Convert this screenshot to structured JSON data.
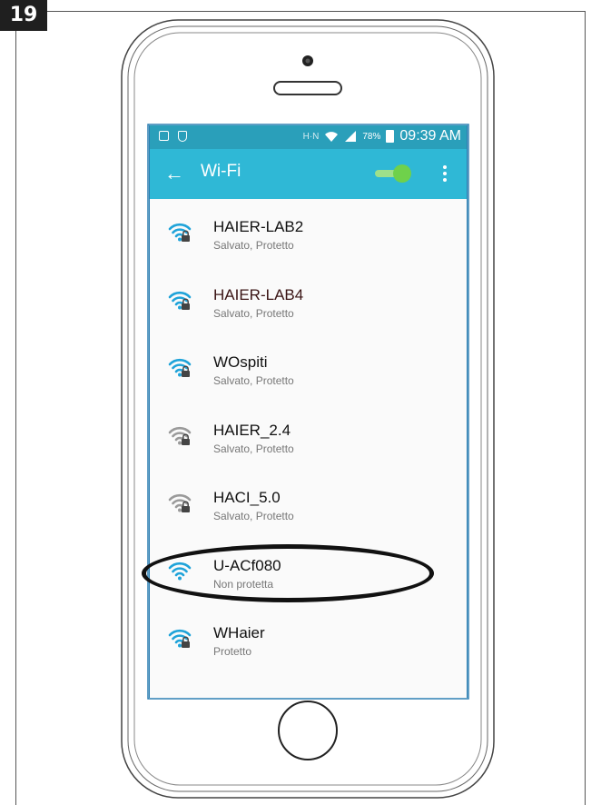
{
  "step_number": "19",
  "status_bar": {
    "battery_percent": "78%",
    "time": "09:39 AM",
    "icons": [
      "image-notification-icon",
      "shield-notification-icon",
      "nfc-icon",
      "wifi-status-icon",
      "signal-icon",
      "battery-icon"
    ]
  },
  "app_bar": {
    "back_icon": "arrow-left-icon",
    "title": "Wi-Fi",
    "toggle_state": "on",
    "menu_icon": "more-vertical-icon"
  },
  "colors": {
    "status_bar": "#2a9fba",
    "app_bar": "#2fb8d6",
    "toggle_on": "#6fd14b",
    "wifi_strong": "#1fa3d9",
    "wifi_weak": "#9a9a9a"
  },
  "networks": [
    {
      "ssid": "HAIER-LAB2",
      "status": "Salvato, Protetto",
      "secured": true,
      "signal": "strong"
    },
    {
      "ssid": "HAIER-LAB4",
      "status": "Salvato, Protetto",
      "secured": true,
      "signal": "strong"
    },
    {
      "ssid": "WOspiti",
      "status": "Salvato, Protetto",
      "secured": true,
      "signal": "strong"
    },
    {
      "ssid": "HAIER_2.4",
      "status": "Salvato, Protetto",
      "secured": true,
      "signal": "weak"
    },
    {
      "ssid": "HACI_5.0",
      "status": "Salvato, Protetto",
      "secured": true,
      "signal": "weak"
    },
    {
      "ssid": "U-ACf080",
      "status": "Non protetta",
      "secured": false,
      "signal": "strong",
      "highlighted": true
    },
    {
      "ssid": "WHaier",
      "status": "Protetto",
      "secured": true,
      "signal": "strong"
    }
  ]
}
